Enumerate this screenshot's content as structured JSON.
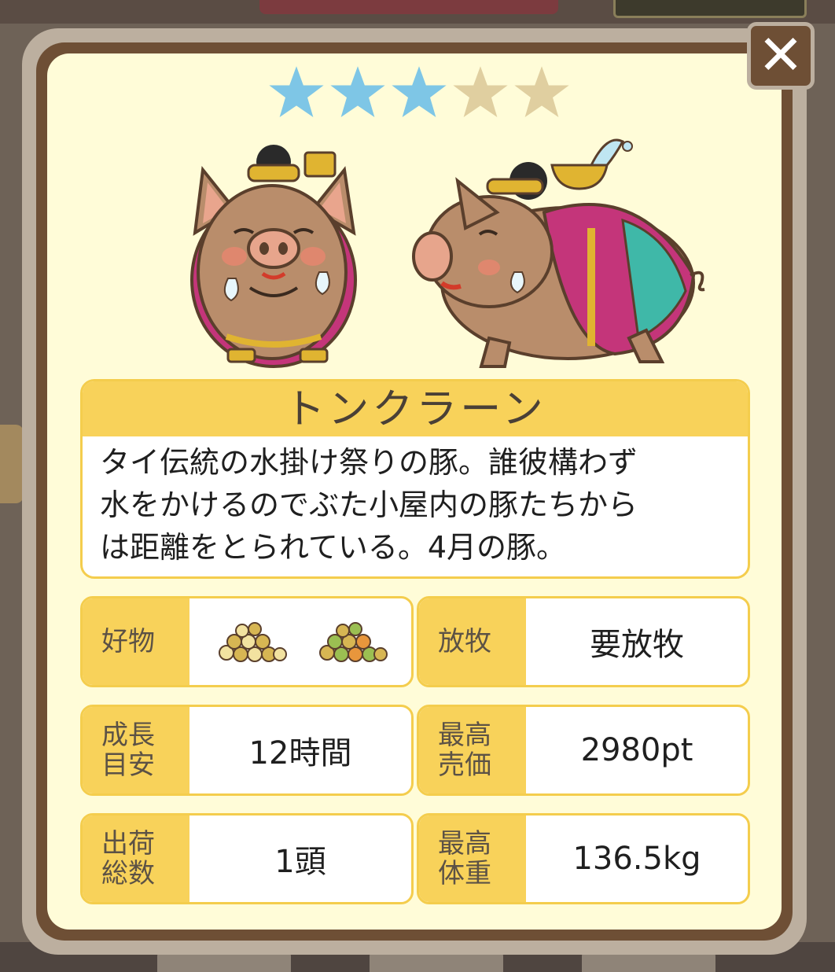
{
  "rating": {
    "filled": 3,
    "total": 5,
    "filled_color": "#7ec6e6",
    "empty_color": "#e0cfa0"
  },
  "pig": {
    "name": "トンクラーン",
    "description_lines": [
      "タイ伝統の水掛け祭りの豚。誰彼構わず",
      "水をかけるのでぶた小屋内の豚たちから",
      "は距離をとられている。4月の豚。"
    ]
  },
  "stats": {
    "favorite": {
      "label": "好物",
      "icons": [
        "yellow-beans-icon",
        "green-beans-icon"
      ]
    },
    "grazing": {
      "label": "放牧",
      "value": "要放牧"
    },
    "growth": {
      "label": "成長\n目安",
      "value": "12時間"
    },
    "max_price": {
      "label": "最高\n売価",
      "value": "2980pt"
    },
    "shipped": {
      "label": "出荷\n総数",
      "value": "1頭"
    },
    "max_weight": {
      "label": "最高\n体重",
      "value": "136.5kg"
    }
  },
  "colors": {
    "panel_yellow": "#f8d25a",
    "frame_brown": "#6e4f35",
    "card_cream": "#fffcd8"
  }
}
